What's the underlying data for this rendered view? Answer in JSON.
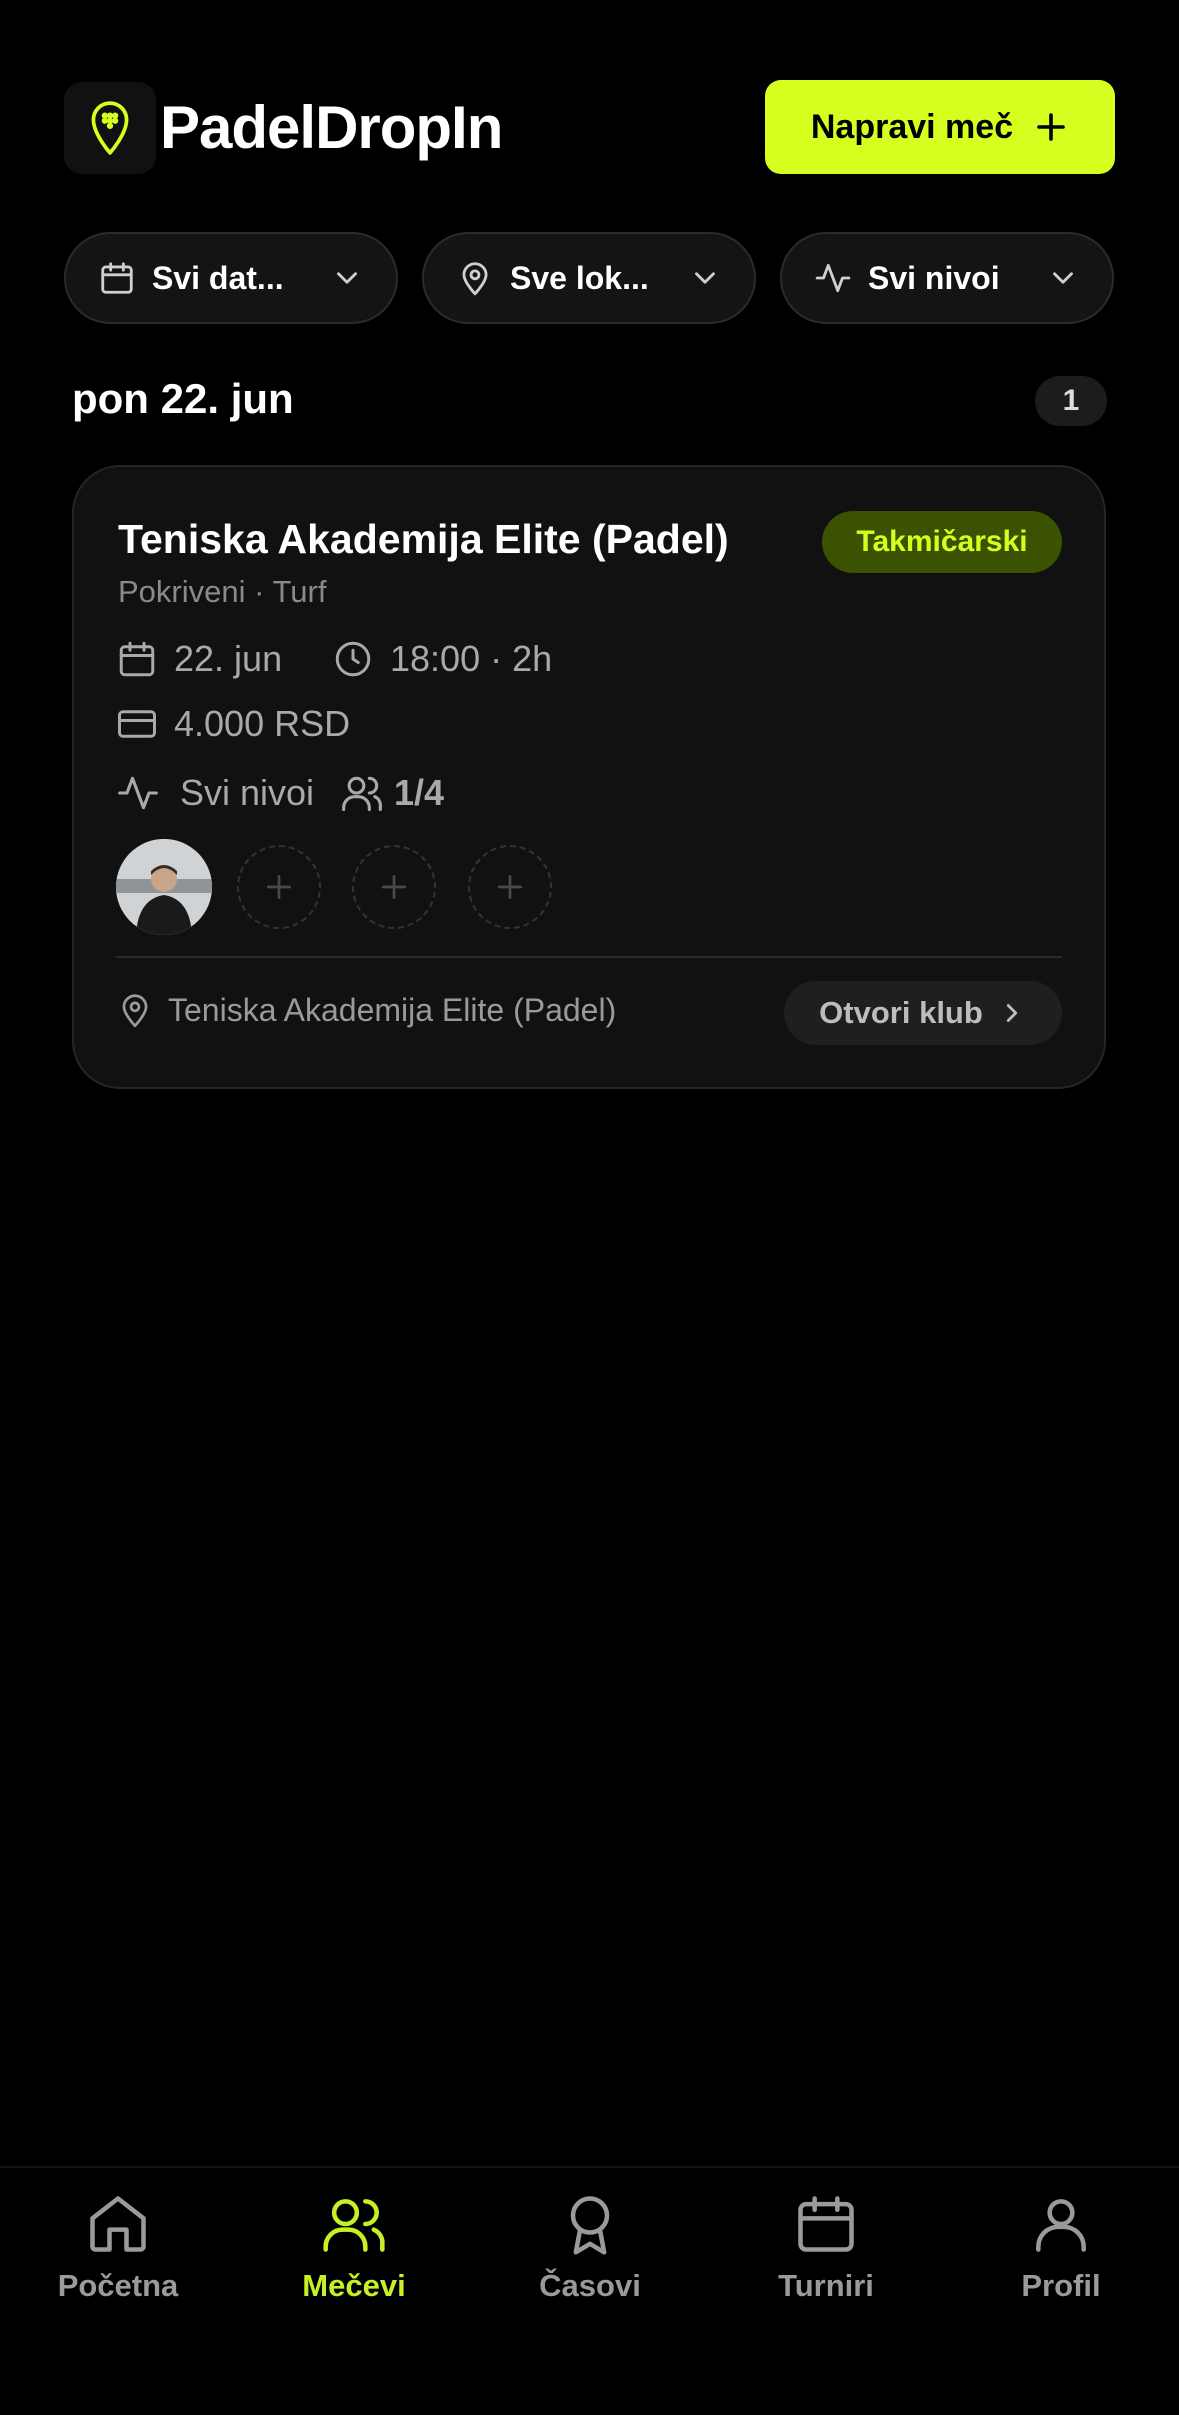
{
  "app": {
    "title": "PadelDropIn"
  },
  "header": {
    "create_label": "Napravi meč"
  },
  "filters": [
    {
      "label": "Svi dat...",
      "icon": "calendar-icon"
    },
    {
      "label": "Sve lok...",
      "icon": "location-pin-icon"
    },
    {
      "label": "Svi nivoi",
      "icon": "activity-icon"
    }
  ],
  "section": {
    "date": "pon 22. jun",
    "count": "1"
  },
  "match": {
    "title": "Teniska Akademija Elite (Padel)",
    "tag": "Takmičarski",
    "subtitle": "Pokriveni · Turf",
    "date": "22. jun",
    "time": "18:00 · 2h",
    "price": "4.000 RSD",
    "level": "Svi nivoi",
    "players": "1/4",
    "location": "Teniska Akademija Elite (Padel)",
    "club_button": "Otvori klub"
  },
  "nav": [
    {
      "label": "Početna",
      "icon": "home-icon"
    },
    {
      "label": "Mečevi",
      "icon": "users-icon",
      "active": true
    },
    {
      "label": "Časovi",
      "icon": "award-icon"
    },
    {
      "label": "Turniri",
      "icon": "calendar-icon"
    },
    {
      "label": "Profil",
      "icon": "user-icon"
    }
  ],
  "colors": {
    "accent": "#d4ff1f",
    "background": "#000000",
    "card": "#111111",
    "tag_bg": "#3b5200"
  }
}
